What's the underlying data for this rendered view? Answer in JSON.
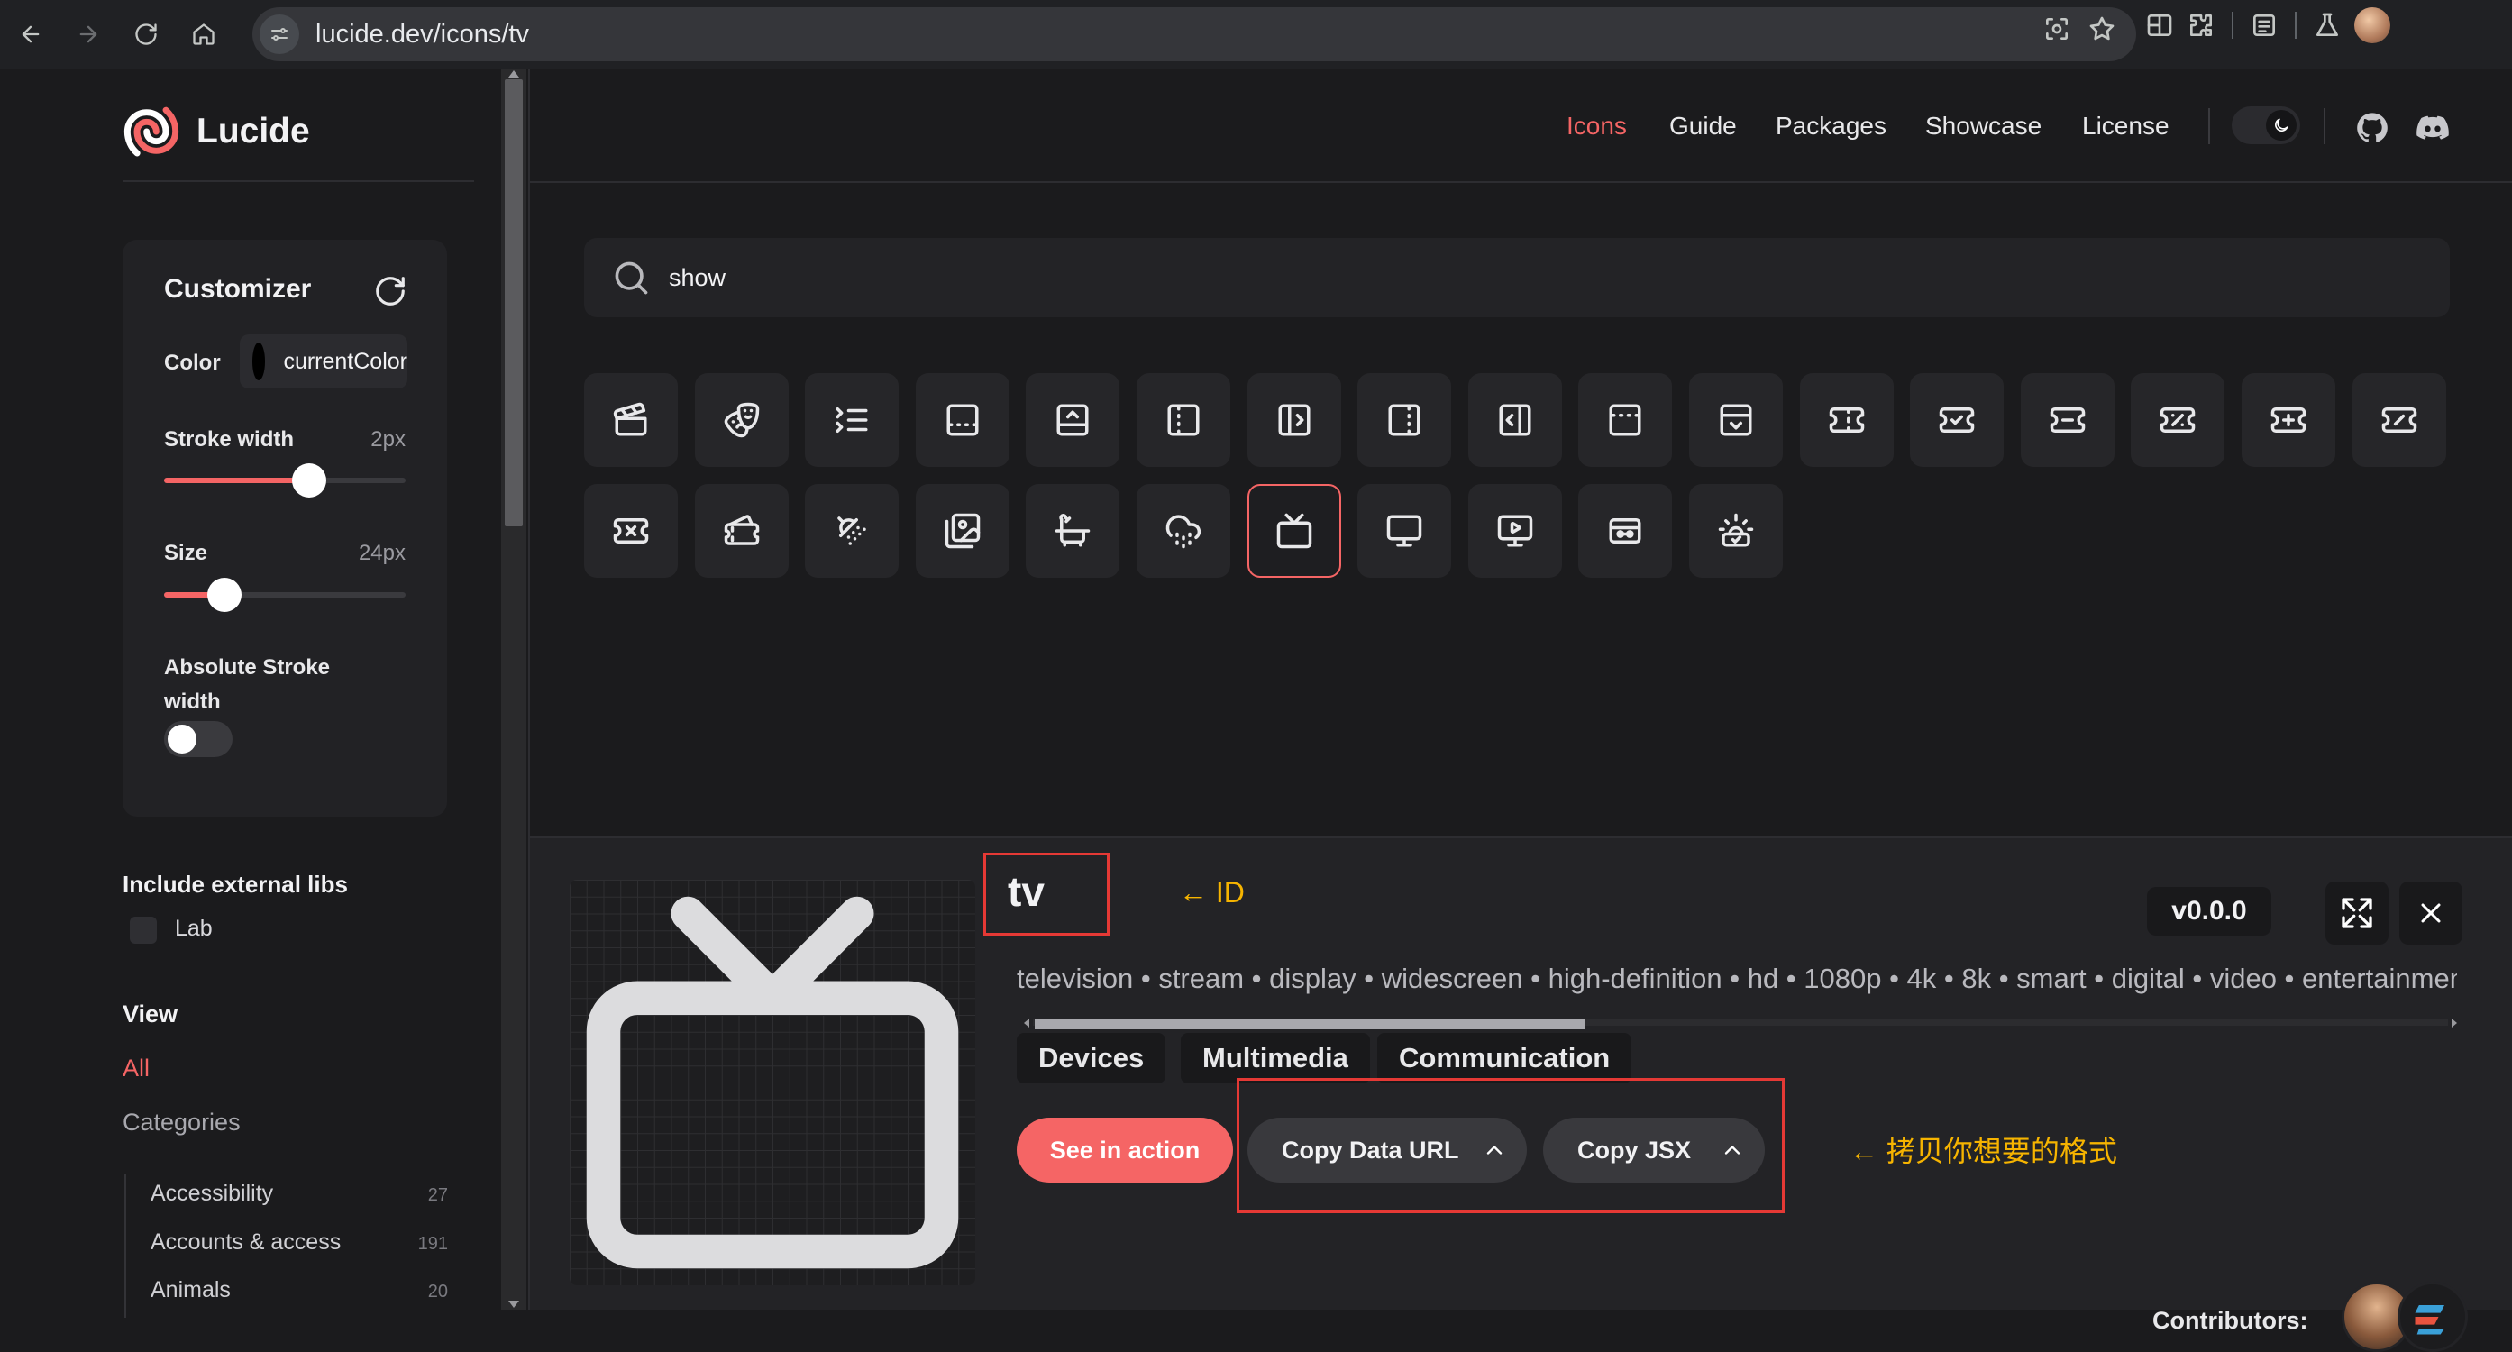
{
  "browser": {
    "url": "lucide.dev/icons/tv"
  },
  "sidebar": {
    "brand": "Lucide",
    "customizer": {
      "title": "Customizer",
      "color_label": "Color",
      "color_value": "currentColor",
      "stroke_width_label": "Stroke width",
      "stroke_width_value": "2px",
      "stroke_width_fraction": 0.6,
      "size_label": "Size",
      "size_value": "24px",
      "size_fraction": 0.25,
      "absolute_stroke_label": "Absolute Stroke width",
      "absolute_stroke_on": false
    },
    "external_libs_title": "Include external libs",
    "external_libs": [
      {
        "label": "Lab",
        "checked": false
      }
    ],
    "view_title": "View",
    "view_all": "All",
    "categories_label": "Categories",
    "categories": [
      {
        "name": "Accessibility",
        "count": "27"
      },
      {
        "name": "Accounts & access",
        "count": "191"
      },
      {
        "name": "Animals",
        "count": "20"
      }
    ]
  },
  "topnav": {
    "links": [
      "Icons",
      "Guide",
      "Packages",
      "Showcase",
      "License"
    ],
    "active": "Icons"
  },
  "search": {
    "value": "show"
  },
  "icon_grid": {
    "icons": [
      "clapperboard",
      "drama",
      "list-collapse",
      "panel-bottom-dashed",
      "panel-bottom-open",
      "panel-left-dashed",
      "panel-left-open",
      "panel-right-dashed",
      "panel-right-open",
      "panel-top-dashed",
      "panel-top-open",
      "ticket",
      "ticket-check",
      "ticket-minus",
      "ticket-percent",
      "ticket-plus",
      "ticket-slash",
      "ticket-x",
      "tickets",
      "shower-head",
      "images",
      "bath",
      "cloud-drizzle",
      "tv",
      "monitor",
      "monitor-play",
      "tv-minimal-play",
      "cctv-sunrise"
    ],
    "selected": "tv"
  },
  "detail": {
    "name": "tv",
    "id_annotation": "← ID",
    "tags": "television • stream • display • widescreen • high-definition • hd • 1080p • 4k • 8k • smart • digital • video • entertainment • showtime • channels • terrestrial • satellite • cable • broadcast • live • frequency • tune • scan • aerial • receiver • transmission • signal • connection • connectivity",
    "categories": [
      "Devices",
      "Multimedia",
      "Communication"
    ],
    "see_in_action": "See in action",
    "copy_data_url": "Copy Data URL",
    "copy_jsx": "Copy JSX",
    "copy_annotation": "← 拷贝你想要的格式",
    "version": "v0.0.0",
    "contributors_label": "Contributors:"
  },
  "colors": {
    "accent": "#f56565",
    "annotation_box": "#e53935",
    "annotation_text": "#f6b400"
  }
}
